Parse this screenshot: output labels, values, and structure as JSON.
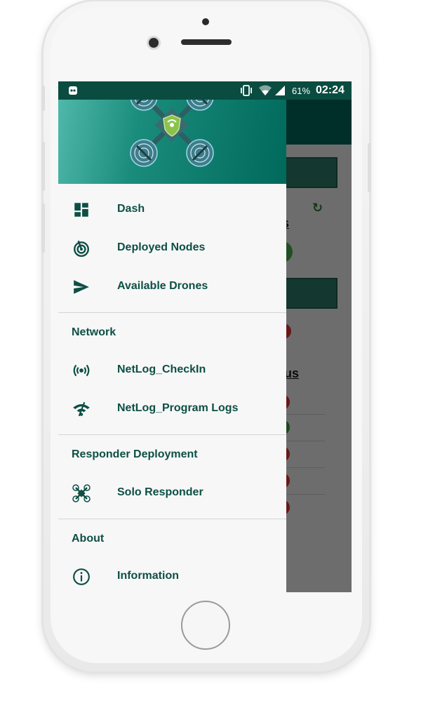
{
  "status_bar": {
    "battery": "61%",
    "time": "02:24"
  },
  "background": {
    "partial_heading_1": "s",
    "partial_heading_2": "tus"
  },
  "drawer": {
    "items_primary": [
      {
        "label": "Dash",
        "icon": "dashboard-icon"
      },
      {
        "label": "Deployed Nodes",
        "icon": "radar-icon"
      },
      {
        "label": "Available Drones",
        "icon": "send-icon"
      }
    ],
    "sections": [
      {
        "title": "Network",
        "items": [
          {
            "label": "NetLog_CheckIn",
            "icon": "broadcast-icon"
          },
          {
            "label": "NetLog_Program Logs",
            "icon": "wifi-off-icon"
          }
        ]
      },
      {
        "title": "Responder Deployment",
        "items": [
          {
            "label": "Solo Responder",
            "icon": "drone-icon"
          }
        ]
      },
      {
        "title": "About",
        "items": [
          {
            "label": "Information",
            "icon": "info-icon"
          }
        ]
      }
    ]
  },
  "colors": {
    "accent": "#0d4f45",
    "header_start": "#4fb8aa",
    "header_end": "#00695c",
    "status_bar": "#0a4c40"
  }
}
